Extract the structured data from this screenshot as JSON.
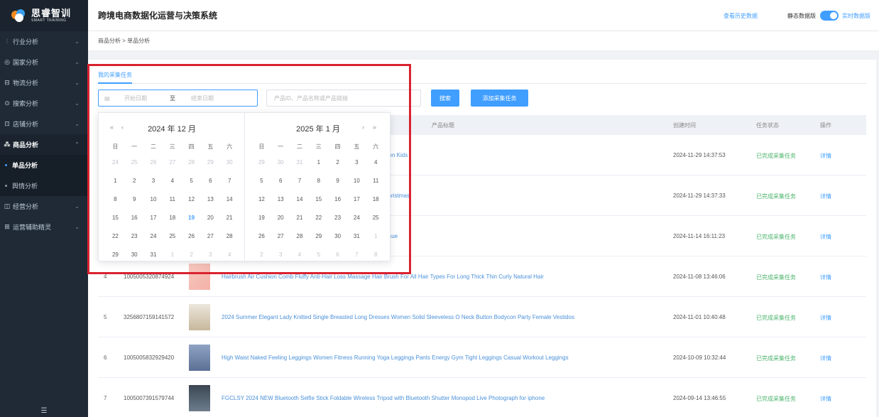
{
  "sidebar": {
    "logo_cn": "思睿智训",
    "logo_en": "SMART TRAINING",
    "items": [
      {
        "label": "行业分析",
        "icon": "chart-icon",
        "glyph": "⫶"
      },
      {
        "label": "国家分析",
        "icon": "globe-icon",
        "glyph": "◎"
      },
      {
        "label": "物流分析",
        "icon": "truck-icon",
        "glyph": "⊟"
      },
      {
        "label": "搜索分析",
        "icon": "search-icon",
        "glyph": "⊙"
      },
      {
        "label": "店铺分析",
        "icon": "store-icon",
        "glyph": "⊡"
      },
      {
        "label": "商品分析",
        "icon": "goods-icon",
        "glyph": "⁂"
      },
      {
        "label": "经营分析",
        "icon": "business-icon",
        "glyph": "◫"
      },
      {
        "label": "运营辅助精灵",
        "icon": "assistant-icon",
        "glyph": "⊞"
      }
    ],
    "sub_items": [
      "单品分析",
      "舆情分析"
    ],
    "footer_glyph": "☰"
  },
  "header": {
    "title": "跨境电商数据化运营与决策系统",
    "history_link": "查看历史数据",
    "toggle_left": "静态数据版",
    "toggle_right": "实时数据版"
  },
  "breadcrumb": "商品分析 > 单品分析",
  "tab": "我的采集任务",
  "filters": {
    "start_placeholder": "开始日期",
    "separator": "至",
    "end_placeholder": "结束日期",
    "product_placeholder": "产品ID、产品名称或产品链接",
    "search_button": "搜索",
    "add_button": "添加采集任务"
  },
  "table": {
    "headers": [
      "产品标题",
      "创建时间",
      "任务状态",
      "操作"
    ],
    "rows": [
      {
        "idx": "",
        "pid": "",
        "title": "n Puzzles Training Brain Learing Early Educational Toys For Children Kids",
        "time": "2024-11-29 14:37:53",
        "status": "已完成采集任务",
        "op": "详情"
      },
      {
        "idx": "",
        "pid": "",
        "title": "y Party Entertainment UNO Games Card Toys Children Birthday Christmas",
        "time": "2024-11-29 14:37:33",
        "status": "已完成采集任务",
        "op": "详情"
      },
      {
        "idx": "",
        "pid": "",
        "title": "Wipes Facial Cloths Towelettes For Washing And Drying Facial Tissue",
        "time": "2024-11-14 16:11:23",
        "status": "已完成采集任务",
        "op": "详情"
      },
      {
        "idx": "4",
        "pid": "1005005320874924",
        "title": "Hairbrush Air Cushion Comb Fluffy Anti-Hair Loss Massage Hair Brush For All Hair Types For Long Thick Thin Curly Natural Hair",
        "time": "2024-11-08 13:46:06",
        "status": "已完成采集任务",
        "op": "详情"
      },
      {
        "idx": "5",
        "pid": "3256807159141572",
        "title": "2024 Summer Elegant Lady Knitted Single Breasted Long Dresses Women Solid Sleeveless O Neck Button Bodycon Party Female Vestidos",
        "time": "2024-11-01 10:40:48",
        "status": "已完成采集任务",
        "op": "详情"
      },
      {
        "idx": "6",
        "pid": "1005005832929420",
        "title": "High Waist Naked Feeling Leggings Women Fitness Running Yoga Leggings Pants Energy Gym Tight Leggings Casual Workout Leggings",
        "time": "2024-10-09 10:32:44",
        "status": "已完成采集任务",
        "op": "详情"
      },
      {
        "idx": "7",
        "pid": "1005007391579744",
        "title": "FGCLSY 2024 NEW Bluetooth Selfie Stick Foldable Wireless Tripod with Bluetooth Shutter Monopod Live Photograph for iphone",
        "time": "2024-09-14 13:46:55",
        "status": "已完成采集任务",
        "op": "详情"
      }
    ]
  },
  "picker": {
    "left_title": "2024 年 12 月",
    "right_title": "2025 年 1 月",
    "weekdays": [
      "日",
      "一",
      "二",
      "三",
      "四",
      "五",
      "六"
    ],
    "left_weeks": [
      [
        "24",
        "25",
        "26",
        "27",
        "28",
        "29",
        "30"
      ],
      [
        "1",
        "2",
        "3",
        "4",
        "5",
        "6",
        "7"
      ],
      [
        "8",
        "9",
        "10",
        "11",
        "12",
        "13",
        "14"
      ],
      [
        "15",
        "16",
        "17",
        "18",
        "19",
        "20",
        "21"
      ],
      [
        "22",
        "23",
        "24",
        "25",
        "26",
        "27",
        "28"
      ],
      [
        "29",
        "30",
        "31",
        "1",
        "2",
        "3",
        "4"
      ]
    ],
    "right_weeks": [
      [
        "29",
        "30",
        "31",
        "1",
        "2",
        "3",
        "4"
      ],
      [
        "5",
        "6",
        "7",
        "8",
        "9",
        "10",
        "11"
      ],
      [
        "12",
        "13",
        "14",
        "15",
        "16",
        "17",
        "18"
      ],
      [
        "19",
        "20",
        "21",
        "22",
        "23",
        "24",
        "25"
      ],
      [
        "26",
        "27",
        "28",
        "29",
        "30",
        "31",
        "1"
      ],
      [
        "2",
        "3",
        "4",
        "5",
        "6",
        "7",
        "8"
      ]
    ],
    "today": "19",
    "nav_prev_year": "«",
    "nav_prev_month": "‹",
    "nav_next_month": "›",
    "nav_next_year": "»"
  }
}
